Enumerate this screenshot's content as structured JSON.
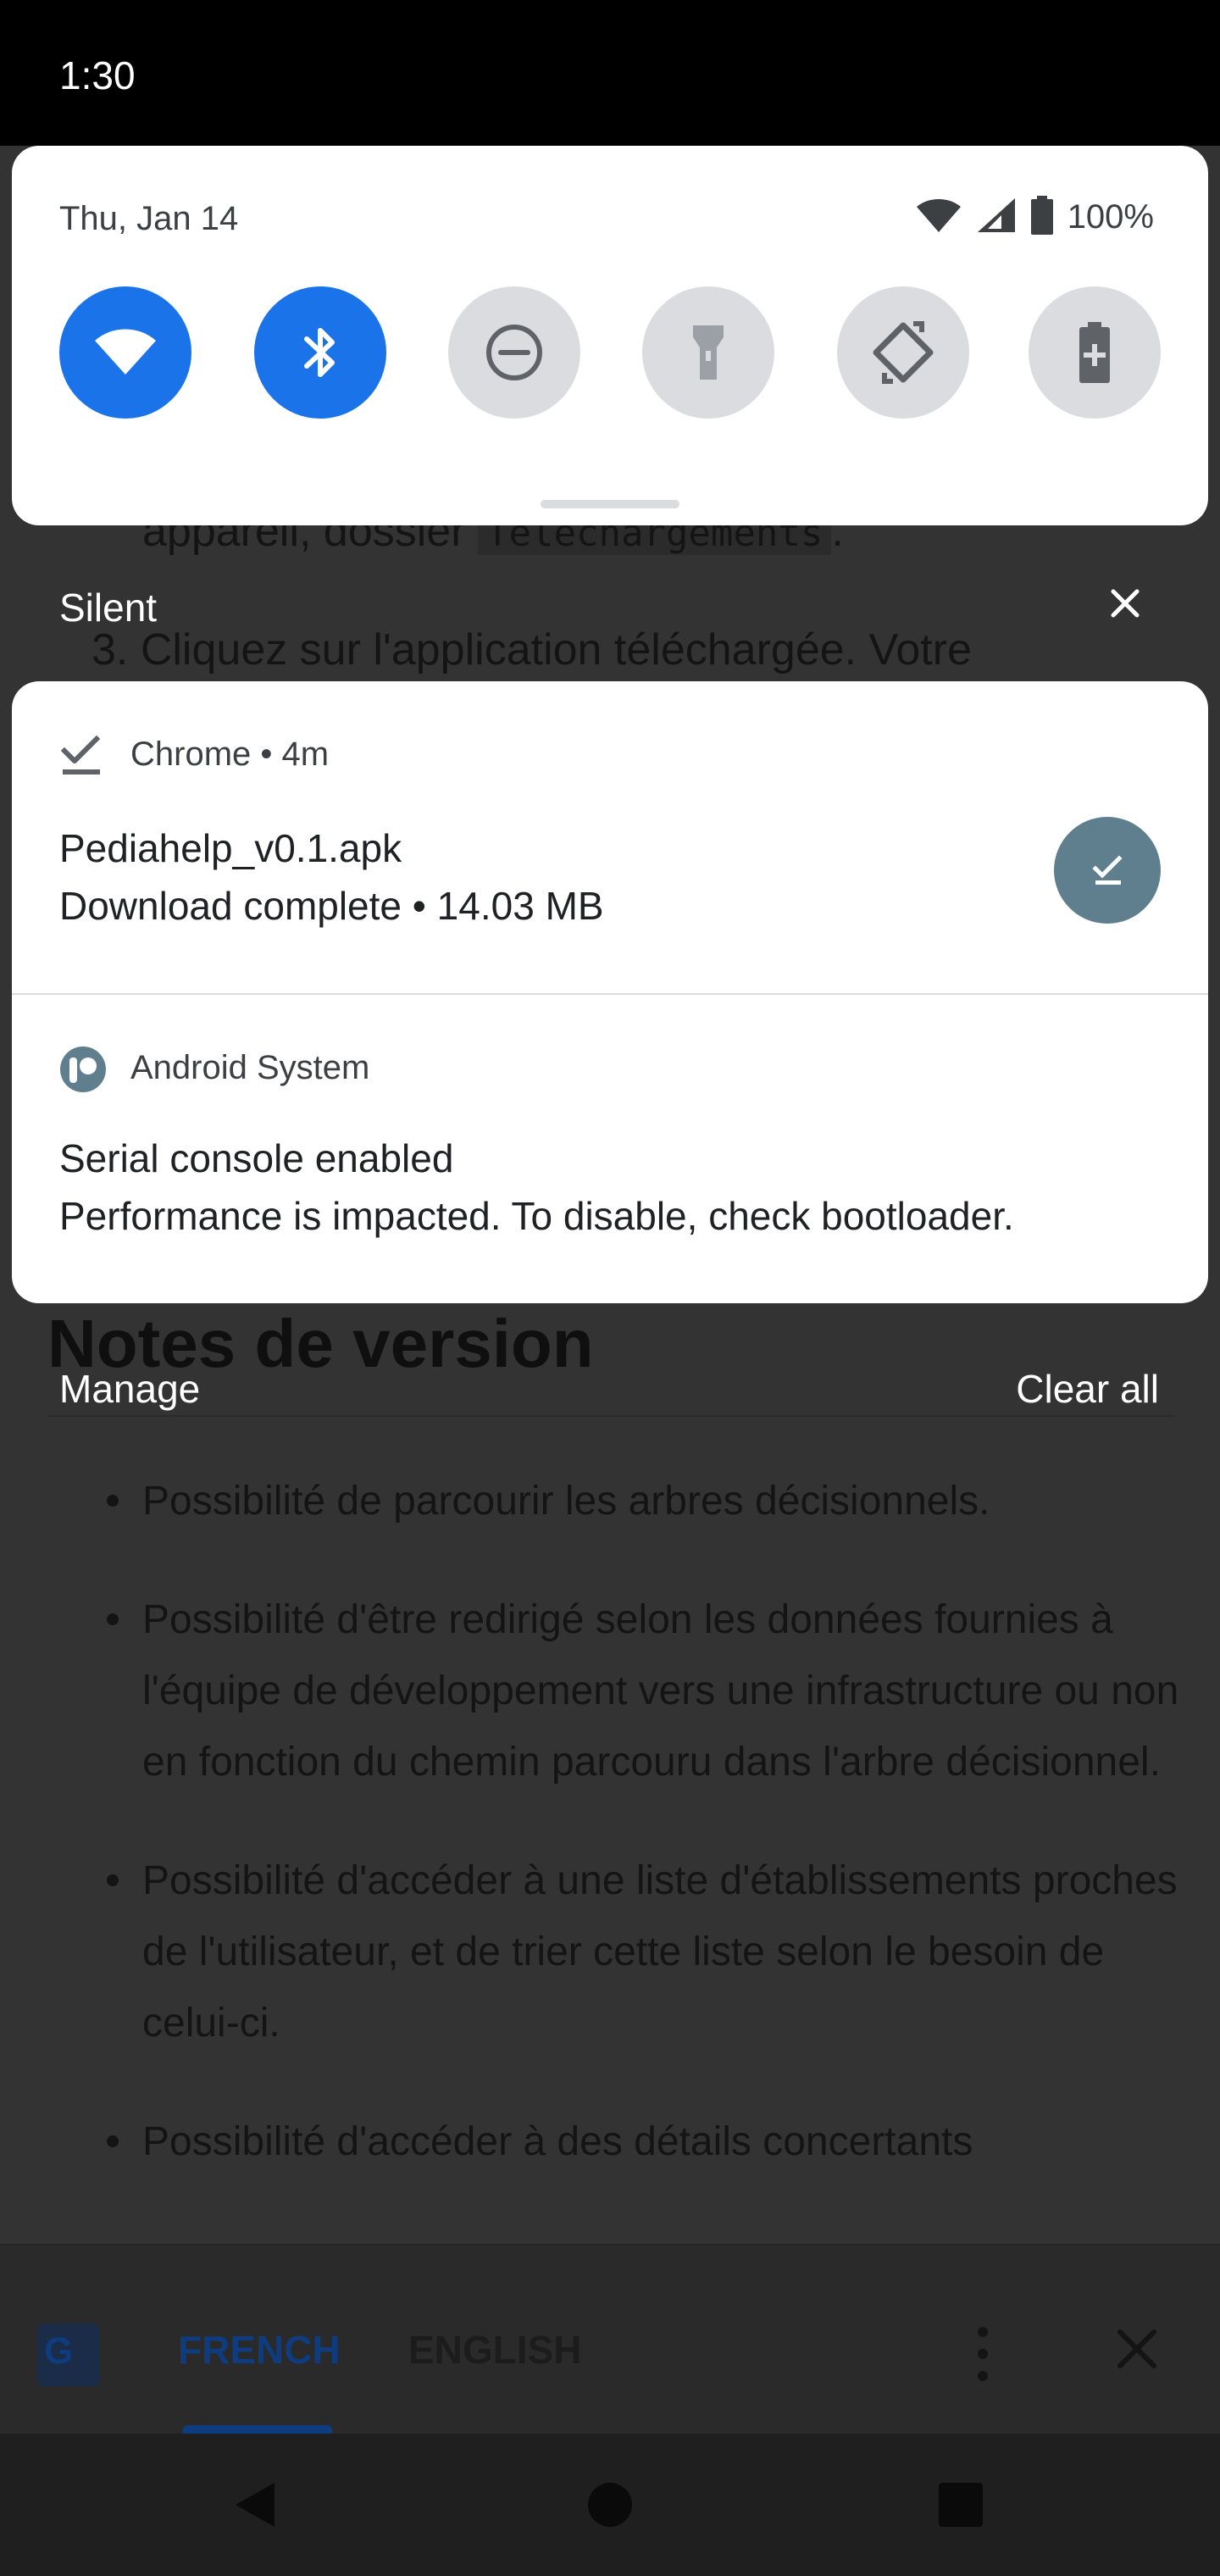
{
  "status_bar": {
    "time": "1:30"
  },
  "quick_settings": {
    "date": "Thu, Jan 14",
    "battery_percent": "100%",
    "tiles": [
      {
        "name": "wifi",
        "state": "on"
      },
      {
        "name": "bluetooth",
        "state": "on"
      },
      {
        "name": "do-not-disturb",
        "state": "off"
      },
      {
        "name": "flashlight",
        "state": "off"
      },
      {
        "name": "auto-rotate",
        "state": "off"
      },
      {
        "name": "battery-saver",
        "state": "off"
      }
    ]
  },
  "notification_section": {
    "label": "Silent"
  },
  "notifications": [
    {
      "app": "Chrome",
      "time": "4m",
      "header": "Chrome • 4m",
      "title": "Pediahelp_v0.1.apk",
      "text": "Download complete • 14.03 MB",
      "app_icon": "download-done-icon",
      "action_icon": "download-done-icon"
    },
    {
      "app": "Android System",
      "header": "Android System",
      "title": "Serial console enabled",
      "text": "Performance is impacted. To disable, check bootloader.",
      "app_icon": "android-system-icon"
    }
  ],
  "shade_actions": {
    "manage": "Manage",
    "clear_all": "Clear all"
  },
  "background_page": {
    "line_1_prefix": "appareil, dossier ",
    "line_1_code": "Téléchargements",
    "line_1_suffix": ".",
    "line_2": "3. Cliquez sur l'application téléchargée. Votre",
    "heading": "Notes de version",
    "bullets": [
      "Possibilité de parcourir les arbres décisionnels.",
      "Possibilité d'être redirigé selon les données fournies à l'équipe de développement vers une infrastructure ou non en fonction du chemin parcouru dans l'arbre décisionnel.",
      "Possibilité d'accéder à une liste d'établissements proches de l'utilisateur, et de trier cette liste selon le besoin de celui-ci.",
      "Possibilité d'accéder à des détails concertants"
    ]
  },
  "translate_bar": {
    "logo_text": "G",
    "tab_source": "FRENCH",
    "tab_target": "ENGLISH"
  },
  "colors": {
    "accent": "#1a73e8",
    "tile_off": "#dadce0",
    "chrome_action": "#5f7f8e"
  }
}
